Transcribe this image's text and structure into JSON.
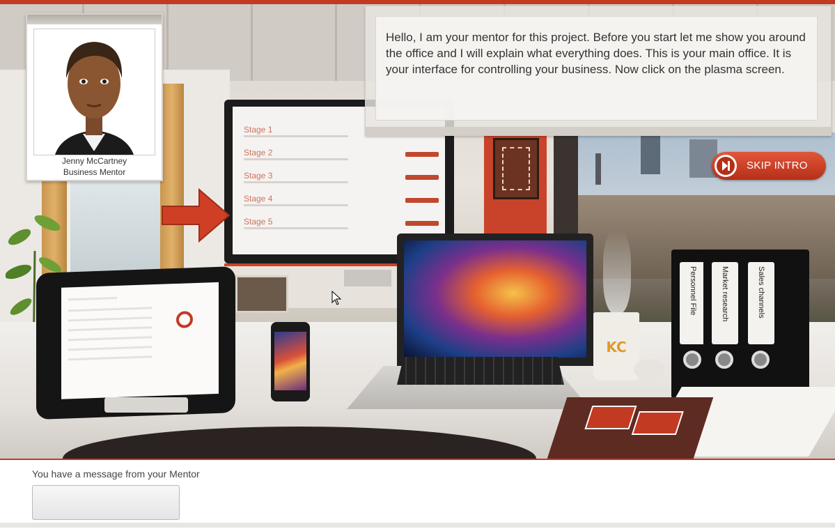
{
  "mentor": {
    "name": "Jenny McCartney",
    "role": "Business Mentor"
  },
  "dialog": {
    "message": "Hello, I am your mentor for this project. Before you start let me show you around the office and I will explain what everything does. This is your main office. It is your interface for controlling your business. Now click on the plasma screen."
  },
  "skip_button": {
    "label": "SKIP INTRO",
    "icon": "skip-forward-icon",
    "color": "#c23a22"
  },
  "plasma_screen": {
    "stages": [
      "Stage 1",
      "Stage 2",
      "Stage 3",
      "Stage 4",
      "Stage 5"
    ]
  },
  "binders": [
    "Personnel File",
    "Market research",
    "Sales channels"
  ],
  "cup": {
    "logo": "KC"
  },
  "bottom_panel": {
    "message_label": "You have a message from your Mentor",
    "message_box_text": ""
  },
  "colors": {
    "accent": "#c23a22",
    "panel_bg": "#ffffff"
  }
}
